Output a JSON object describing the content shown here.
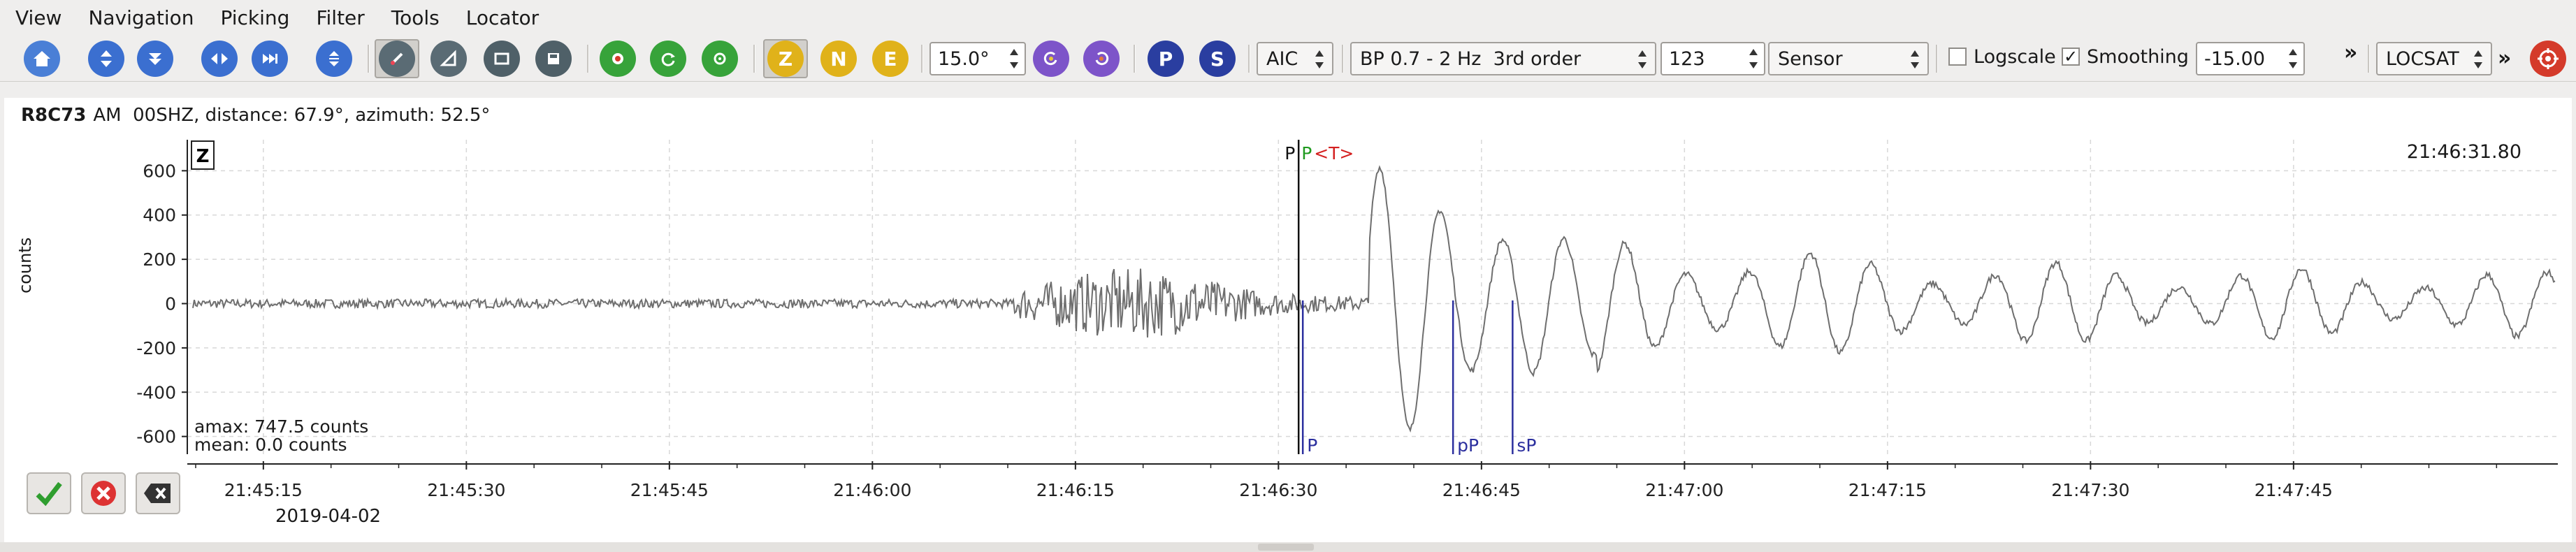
{
  "menu": [
    "View",
    "Navigation",
    "Picking",
    "Filter",
    "Tools",
    "Locator"
  ],
  "toolbar": {
    "angle_value": "15.0°",
    "picker": "AIC",
    "filter": "BP 0.7 - 2 Hz  3rd order",
    "number": "123",
    "sensor": "Sensor",
    "logscale_label": "Logscale",
    "logscale_checked": false,
    "smoothing_label": "Smoothing",
    "smoothing_checked": true,
    "smoothing_value": "-15.00",
    "overflow_glyph": "»",
    "locator": "LOCSAT",
    "channel_buttons": [
      "Z",
      "N",
      "E"
    ],
    "phase_buttons": [
      "P",
      "S"
    ],
    "colors": {
      "blue": "#3b6fd0",
      "green": "#37a33a",
      "yellow": "#e0b21a",
      "purple": "#7d54c9",
      "navy": "#2a3ea0",
      "red": "#d43a2a"
    }
  },
  "trace": {
    "station": "R8C73",
    "header": "AM  00SHZ, distance: 67.9°, azimuth: 52.5°",
    "component_badge": "Z",
    "time_readout": "21:46:31.80",
    "ylabel": "counts",
    "amax": "amax: 747.5 counts",
    "mean": "mean: 0.0 counts",
    "date": "2019-04-02",
    "marker_top_black": "P",
    "marker_top_green": "P",
    "marker_top_red": "<T>",
    "phase_labels": [
      "P",
      "pP",
      "sP"
    ]
  },
  "chart_data": {
    "type": "line",
    "ylabel": "counts",
    "y_ticks": [
      600,
      400,
      200,
      0,
      -200,
      -400,
      -600
    ],
    "x_ticks": [
      "21:45:15",
      "21:45:30",
      "21:45:45",
      "21:46:00",
      "21:46:15",
      "21:46:30",
      "21:46:45",
      "21:47:00",
      "21:47:15",
      "21:47:30",
      "21:47:45"
    ],
    "ylim": [
      -680,
      740
    ],
    "grid": true,
    "phase_picks": [
      {
        "label": "P",
        "time": "21:46:31.8"
      },
      {
        "label": "pP",
        "time": "21:46:42.9"
      },
      {
        "label": "sP",
        "time": "21:46:47.3"
      }
    ]
  }
}
